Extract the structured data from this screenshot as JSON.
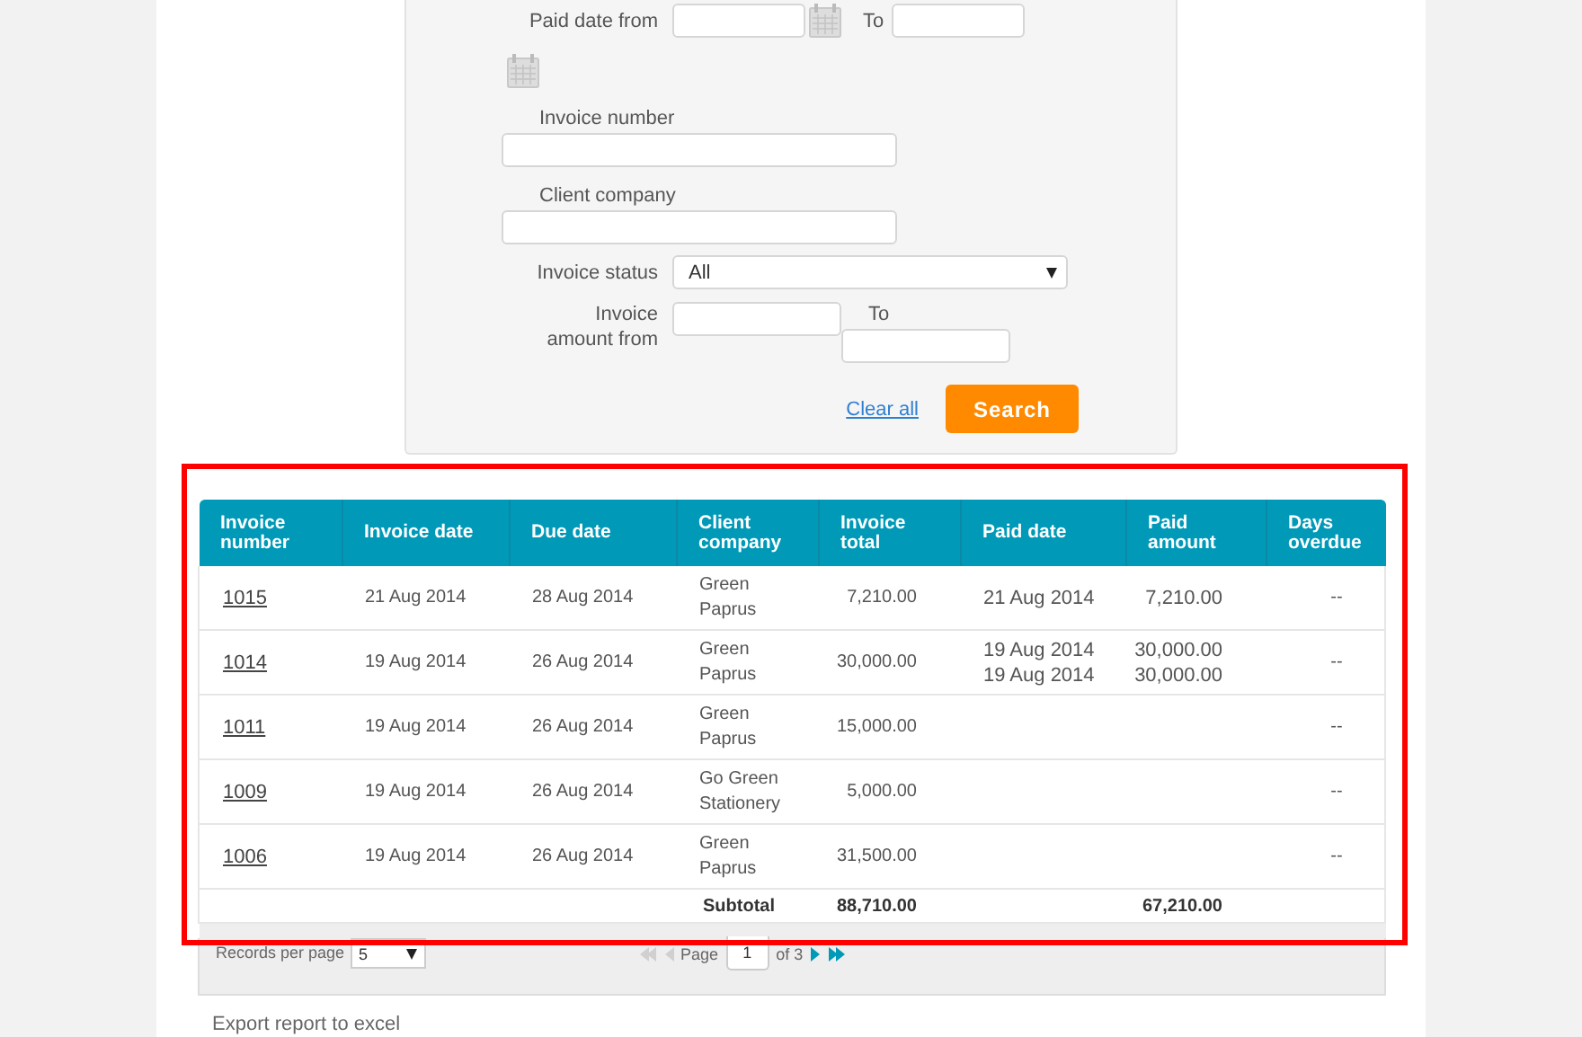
{
  "filter": {
    "paid_date": {
      "label": "Paid date from",
      "to_label": "To"
    },
    "invoice_number": {
      "label": "Invoice number"
    },
    "client_company": {
      "label": "Client company"
    },
    "invoice_status": {
      "label": "Invoice status",
      "value": "All"
    },
    "invoice_amount": {
      "label": "Invoice amount from",
      "to_label": "To"
    },
    "clear_link": "Clear all",
    "search_button": "Search"
  },
  "table": {
    "columns": [
      "Invoice number",
      "Invoice date",
      "Due date",
      "Client company",
      "Invoice total",
      "Paid date",
      "Paid amount",
      "Days overdue"
    ],
    "rows": [
      {
        "invoice_number": "1015",
        "invoice_date": "21 Aug 2014",
        "due_date": "28 Aug 2014",
        "client_company": "Green Paprus",
        "invoice_total": "7,210.00",
        "payments": [
          {
            "paid_date": "21 Aug 2014",
            "paid_amount": "7,210.00"
          }
        ],
        "days_overdue": "--"
      },
      {
        "invoice_number": "1014",
        "invoice_date": "19 Aug 2014",
        "due_date": "26 Aug 2014",
        "client_company": "Green Paprus",
        "invoice_total": "30,000.00",
        "payments": [
          {
            "paid_date": "19 Aug 2014",
            "paid_amount": "30,000.00"
          },
          {
            "paid_date": "19 Aug 2014",
            "paid_amount": "30,000.00"
          }
        ],
        "days_overdue": "--"
      },
      {
        "invoice_number": "1011",
        "invoice_date": "19 Aug 2014",
        "due_date": "26 Aug 2014",
        "client_company": "Green Paprus",
        "invoice_total": "15,000.00",
        "days_overdue": "--"
      },
      {
        "invoice_number": "1009",
        "invoice_date": "19 Aug 2014",
        "due_date": "26 Aug 2014",
        "client_company": "Go Green Stationery",
        "invoice_total": "5,000.00",
        "days_overdue": "--"
      },
      {
        "invoice_number": "1006",
        "invoice_date": "19 Aug 2014",
        "due_date": "26 Aug 2014",
        "client_company": "Green Paprus",
        "invoice_total": "31,500.00",
        "days_overdue": "--"
      }
    ],
    "subtotal": {
      "label": "Subtotal",
      "invoice_total": "88,710.00",
      "paid_amount": "67,210.00"
    }
  },
  "pager": {
    "records_label": "Records per page",
    "records_value": "5",
    "page_label": "Page",
    "page_value": "1",
    "of_label": "of 3"
  },
  "export_link": "Export report to excel"
}
